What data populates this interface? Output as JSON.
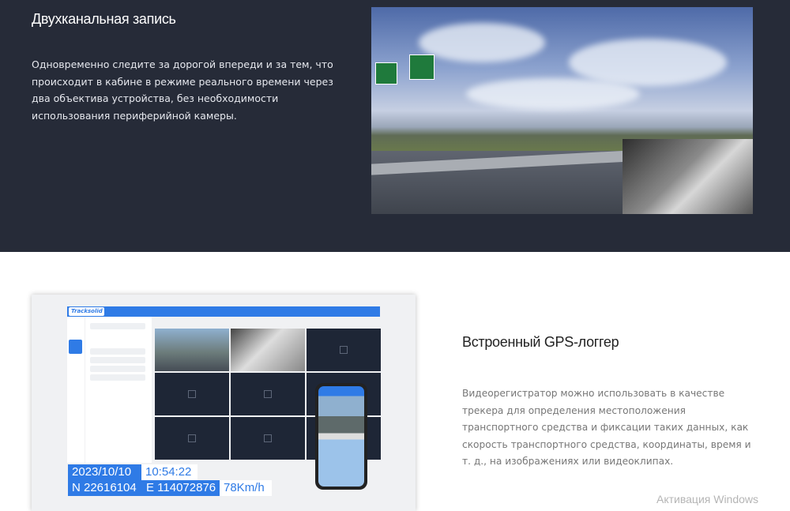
{
  "section1": {
    "title": "Двухканальная запись",
    "text": "Одновременно следите за дорогой впереди и за тем, что происходит в кабине в режиме реального времени через два объектива устройства, без необходимости использования периферийной камеры."
  },
  "section2": {
    "title": "Встроенный GPS-логгер",
    "text": "Видеорегистратор можно использовать в качестве трекера для определения местоположения транспортного средства и фиксации таких данных, как скорость транспортного средства, координаты, время и т. д., на изображениях или видеоклипах.",
    "overlay": {
      "date": "2023/10/10",
      "time": "10:54:22",
      "lat": "N 22616104",
      "lon": "E 114072876",
      "speed": "78Km/h"
    },
    "app_logo": "Tracksolid"
  },
  "watermark": "Активация Windows",
  "colors": {
    "dark_bg": "#262b38",
    "accent": "#2f7be6"
  }
}
